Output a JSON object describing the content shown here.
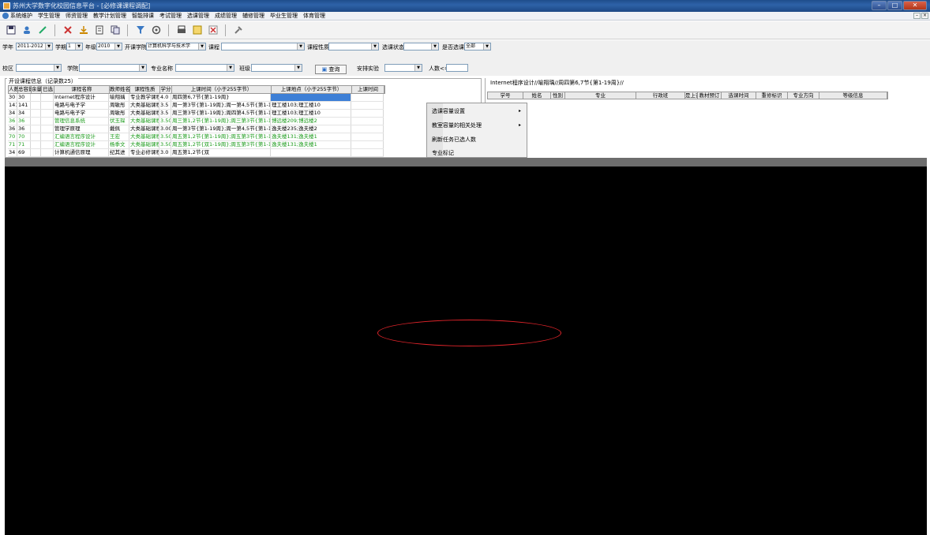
{
  "window": {
    "title": "苏州大学数字化校园信息平台 - [必修课课程调配]"
  },
  "menu": [
    "系统维护",
    "学生管理",
    "师资管理",
    "教学计划管理",
    "智能排课",
    "考试管理",
    "选课管理",
    "成绩管理",
    "辅修管理",
    "毕业生管理",
    "体育管理"
  ],
  "toolbar_icons": [
    "save-icon",
    "users-icon",
    "edit-icon",
    "delete-icon",
    "import-icon",
    "export-icon",
    "copy-icon",
    "filter-icon",
    "settings-icon",
    "print-icon",
    "preview-icon",
    "close-doc-icon",
    "tools-icon"
  ],
  "filters": {
    "xn_label": "学年",
    "xn_value": "2011-2012",
    "xq_label": "学期",
    "xq_value": "1",
    "nj_label": "年级",
    "nj_value": "2010",
    "kkxy_label": "开课学院",
    "kkxy_value": "计算机科学与技术学",
    "kc_label": "课程",
    "kc_value": "",
    "kcxz_label": "课程性质",
    "kcxz_value": "",
    "xkzt_label": "选课状态",
    "xkzt_value": "",
    "sfxk_label": "是否选课",
    "sfxk_value": "全部",
    "xq2_label": "校区",
    "xq2_value": "",
    "xy_label": "学院",
    "xy_value": "",
    "zymc_label": "专业名称",
    "zymc_value": "",
    "bj_label": "班级",
    "bj_value": "",
    "query_label": "查询",
    "apsy_label": "安排实验",
    "apsy_value": "",
    "rs_label": "人数<=",
    "rs_value": ""
  },
  "left_panel": {
    "title": "开设课程信息（记录数25）",
    "headers": [
      "人数",
      "总容量",
      "余量",
      "已选",
      "课程名称",
      "教师姓名",
      "课程性质",
      "学分",
      "上课时间（小于255字节）",
      "上课地点（小于255字节）",
      "上课时间"
    ],
    "rows": [
      [
        "30",
        "30",
        "",
        "",
        "Internet程序设计",
        "喻翔瑀",
        "专业教学课程",
        "4.0",
        "周四第6,7节{第1-19周}",
        "",
        ""
      ],
      [
        "141",
        "141",
        "",
        "",
        "电路与电子学",
        "周敏彤",
        "大类基础课程",
        "3.5",
        "周一第3节{第1-19周};周一第4,5节{第1-19周}",
        "理工楼103;理工楼10",
        ""
      ],
      [
        "34",
        "34",
        "",
        "",
        "电路与电子学",
        "周敏彤",
        "大类基础课程",
        "3.5",
        "周三第3节{第1-19周};周四第4,5节{第1-19周}",
        "理工楼103;理工楼10",
        ""
      ],
      [
        "36",
        "36",
        "",
        "",
        "管理信息系统",
        "伏玉琛",
        "大类基础课程",
        "3.50",
        "周三第1,2节{第1-19周};周三第3节{第1-19周}",
        "博远楼209;博远楼2",
        ""
      ],
      [
        "36",
        "36",
        "",
        "",
        "管理学原理",
        "戴佩",
        "大类基础课程",
        "3.00",
        "周一第3节{第1-19周};周一第4,5节{第1-19周}",
        "逸夫楼235;逸夫楼2",
        ""
      ],
      [
        "70",
        "70",
        "",
        "",
        "汇编语言程序设计",
        "王宏",
        "大类基础课程",
        "3.50",
        "周五第1,2节{第1-19周};周五第3节{第1-19周}",
        "逸夫楼131;逸夫楼1",
        ""
      ],
      [
        "71",
        "71",
        "",
        "",
        "汇编语言程序设计",
        "杨季文",
        "大类基础课程",
        "3.50",
        "周五第1,2节{双1-19周};周五第3节{第1-19周}",
        "逸夫楼131;逸夫楼1",
        ""
      ],
      [
        "34",
        "69",
        "",
        "",
        "计算机通信原理",
        "纪其进",
        "专业必修课程",
        "3.0",
        "周五第1,2节{双",
        "",
        " "
      ]
    ]
  },
  "right_panel": {
    "title": "Internet程序设计//喻翔瑀//周四第6,7节{第1-19周}//",
    "headers": [
      "学号",
      "姓名",
      "性别",
      "专业",
      "行政班",
      "是上否",
      "教材预订",
      "选课时间",
      "重修标识",
      "专业方向",
      "等级信息"
    ]
  },
  "context_menu": [
    "选课容量设置",
    "教室容量的相关处理",
    "刷新任务已选人数",
    "专业标记"
  ],
  "colors": {
    "titlebar": "#2e62a8",
    "green_text": "#1a9a1a",
    "highlight": "#e0242a"
  }
}
